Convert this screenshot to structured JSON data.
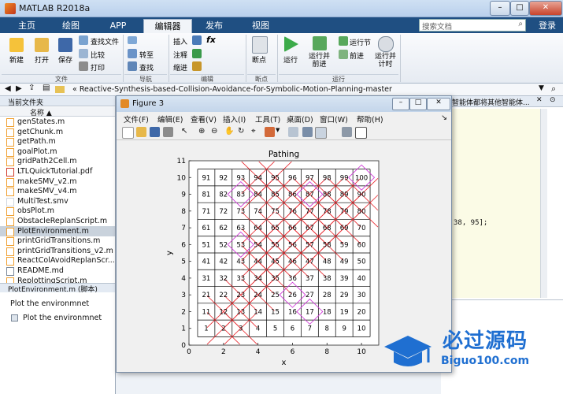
{
  "window": {
    "title": "MATLAB R2018a",
    "minimize": "–",
    "maximize": "□",
    "close": "✕"
  },
  "tabs": [
    {
      "label": "主页"
    },
    {
      "label": "绘图"
    },
    {
      "label": "APP"
    },
    {
      "label": "编辑器"
    },
    {
      "label": "发布"
    },
    {
      "label": "视图"
    }
  ],
  "search": {
    "placeholder": "搜索文档",
    "login": "登录"
  },
  "ribbon": {
    "new": "新建",
    "open": "打开",
    "save": "保存",
    "find_files": "查找文件",
    "compare": "比较",
    "print": "打印",
    "goto": "转至",
    "find": "查找",
    "insert": "插入",
    "comment": "注释",
    "indent": "缩进",
    "breakpoint": "断点",
    "run": "运行",
    "run_advance": "运行并\n前进",
    "run_section": "运行节",
    "advance": "前进",
    "run_time": "运行并\n计时",
    "sections": {
      "file": "文件",
      "nav": "导航",
      "edit": "编辑",
      "bp": "断点",
      "run": "运行"
    }
  },
  "address": {
    "path": "« Reactive-Synthesis-based-Collision-Avoidance-for-Symbolic-Motion-Planning-master"
  },
  "left": {
    "header": "当前文件夹",
    "col_name": "名称 ▲",
    "files": [
      "genStates.m",
      "getChunk.m",
      "getPath.m",
      "goalPlot.m",
      "gridPath2Cell.m",
      "LTLQuickTutorial.pdf",
      "makeSMV_v2.m",
      "makeSMV_v4.m",
      "MultiTest.smv",
      "obsPlot.m",
      "ObstacleReplanScript.m",
      "PlotEnvironment.m",
      "printGridTransitions.m",
      "printGridTransitions_v2.m",
      "ReactColAvoidReplanScr...",
      "README.md",
      "ReplottingScript.m"
    ],
    "selected_index": 11,
    "detail_title": "PlotEnvironment.m (脚本)",
    "detail_desc": "Plot the environmnet",
    "detail_item": "Plot the environmnet"
  },
  "right": {
    "text_top": "智能体都将其他智能体...",
    "code": "38, 95];"
  },
  "figure": {
    "title": "Figure 3",
    "menus": [
      "文件(F)",
      "编辑(E)",
      "查看(V)",
      "插入(I)",
      "工具(T)",
      "桌面(D)",
      "窗口(W)",
      "帮助(H)"
    ]
  },
  "chart_data": {
    "type": "scatter",
    "title": "Pathing",
    "xlabel": "x",
    "ylabel": "y",
    "xlim": [
      0,
      11
    ],
    "ylim": [
      0,
      11
    ],
    "xticks": [
      0,
      2,
      4,
      6,
      8,
      10
    ],
    "yticks": [
      0,
      1,
      2,
      3,
      4,
      5,
      6,
      7,
      8,
      9,
      10,
      11
    ],
    "grid": true,
    "cell_labels": "1 through 100 on a 10×10 grid, cell n centered at (((n-1) mod 10)+1, floor((n-1)/10)+1)",
    "red_x_cells": [
      2,
      3,
      12,
      13,
      23,
      24,
      34,
      35,
      44,
      45,
      46,
      47,
      54,
      55,
      56,
      57,
      58,
      64,
      65,
      66,
      67,
      68,
      69,
      76,
      77,
      78,
      79,
      80,
      84,
      85,
      86,
      87,
      88,
      89,
      90,
      94,
      95
    ],
    "magenta_diamond_cells": [
      26,
      17,
      53,
      83,
      87,
      100
    ],
    "colors": {
      "red": "#e8242a",
      "magenta": "#d13cd9"
    }
  },
  "watermark": {
    "text": "必过源码",
    "url": "Biguo100.com"
  }
}
